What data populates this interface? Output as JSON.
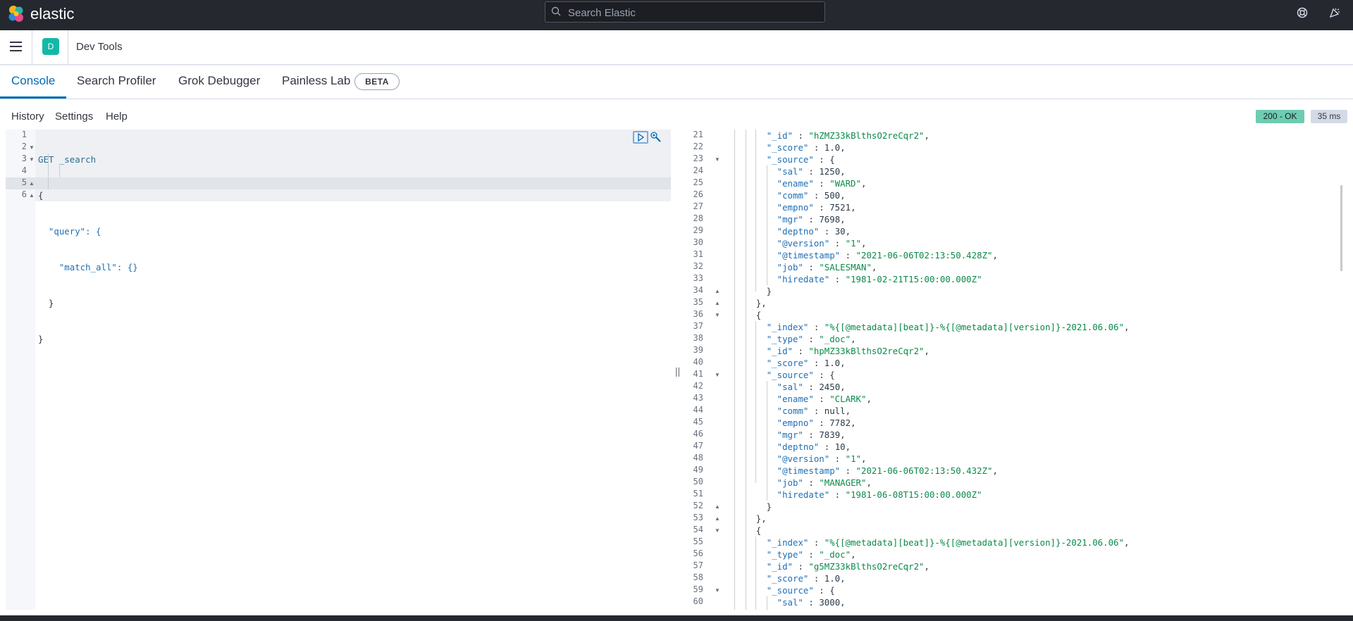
{
  "topbar": {
    "brand": "elastic",
    "search_placeholder": "Search Elastic",
    "icons": [
      "search-icon",
      "help-icon",
      "newsfeed-icon"
    ]
  },
  "appbar": {
    "space_initial": "D",
    "breadcrumb": "Dev Tools"
  },
  "tabs": [
    {
      "label": "Console",
      "active": true
    },
    {
      "label": "Search Profiler",
      "active": false
    },
    {
      "label": "Grok Debugger",
      "active": false
    },
    {
      "label": "Painless Lab",
      "active": false
    }
  ],
  "beta_badge": "BETA",
  "subnav": {
    "history": "History",
    "settings": "Settings",
    "help": "Help"
  },
  "response_status": "200 - OK",
  "response_time": "35 ms",
  "colors": {
    "accent": "#006bb4",
    "status_ok": "#6dccb1",
    "header_bg": "#25282f",
    "space_avatar": "#14b8a6"
  },
  "request_lines": [
    {
      "n": "1",
      "text": "GET _search"
    },
    {
      "n": "2",
      "text": "{"
    },
    {
      "n": "3",
      "text": "  \"query\": {"
    },
    {
      "n": "4",
      "text": "    \"match_all\": {}"
    },
    {
      "n": "5",
      "text": "  }"
    },
    {
      "n": "6",
      "text": "}"
    }
  ],
  "response_lines": [
    {
      "n": "21",
      "text": "        \"_id\" : \"hZMZ33kBlthsO2reCqr2\","
    },
    {
      "n": "22",
      "text": "        \"_score\" : 1.0,"
    },
    {
      "n": "23",
      "text": "        \"_source\" : {"
    },
    {
      "n": "24",
      "text": "          \"sal\" : 1250,"
    },
    {
      "n": "25",
      "text": "          \"ename\" : \"WARD\","
    },
    {
      "n": "26",
      "text": "          \"comm\" : 500,"
    },
    {
      "n": "27",
      "text": "          \"empno\" : 7521,"
    },
    {
      "n": "28",
      "text": "          \"mgr\" : 7698,"
    },
    {
      "n": "29",
      "text": "          \"deptno\" : 30,"
    },
    {
      "n": "30",
      "text": "          \"@version\" : \"1\","
    },
    {
      "n": "31",
      "text": "          \"@timestamp\" : \"2021-06-06T02:13:50.428Z\","
    },
    {
      "n": "32",
      "text": "          \"job\" : \"SALESMAN\","
    },
    {
      "n": "33",
      "text": "          \"hiredate\" : \"1981-02-21T15:00:00.000Z\""
    },
    {
      "n": "34",
      "text": "        }"
    },
    {
      "n": "35",
      "text": "      },"
    },
    {
      "n": "36",
      "text": "      {"
    },
    {
      "n": "37",
      "text": "        \"_index\" : \"%{[@metadata][beat]}-%{[@metadata][version]}-2021.06.06\","
    },
    {
      "n": "38",
      "text": "        \"_type\" : \"_doc\","
    },
    {
      "n": "39",
      "text": "        \"_id\" : \"hpMZ33kBlthsO2reCqr2\","
    },
    {
      "n": "40",
      "text": "        \"_score\" : 1.0,"
    },
    {
      "n": "41",
      "text": "        \"_source\" : {"
    },
    {
      "n": "42",
      "text": "          \"sal\" : 2450,"
    },
    {
      "n": "43",
      "text": "          \"ename\" : \"CLARK\","
    },
    {
      "n": "44",
      "text": "          \"comm\" : null,"
    },
    {
      "n": "45",
      "text": "          \"empno\" : 7782,"
    },
    {
      "n": "46",
      "text": "          \"mgr\" : 7839,"
    },
    {
      "n": "47",
      "text": "          \"deptno\" : 10,"
    },
    {
      "n": "48",
      "text": "          \"@version\" : \"1\","
    },
    {
      "n": "49",
      "text": "          \"@timestamp\" : \"2021-06-06T02:13:50.432Z\","
    },
    {
      "n": "50",
      "text": "          \"job\" : \"MANAGER\","
    },
    {
      "n": "51",
      "text": "          \"hiredate\" : \"1981-06-08T15:00:00.000Z\""
    },
    {
      "n": "52",
      "text": "        }"
    },
    {
      "n": "53",
      "text": "      },"
    },
    {
      "n": "54",
      "text": "      {"
    },
    {
      "n": "55",
      "text": "        \"_index\" : \"%{[@metadata][beat]}-%{[@metadata][version]}-2021.06.06\","
    },
    {
      "n": "56",
      "text": "        \"_type\" : \"_doc\","
    },
    {
      "n": "57",
      "text": "        \"_id\" : \"g5MZ33kBlthsO2reCqr2\","
    },
    {
      "n": "58",
      "text": "        \"_score\" : 1.0,"
    },
    {
      "n": "59",
      "text": "        \"_source\" : {"
    },
    {
      "n": "60",
      "text": "          \"sal\" : 3000,"
    }
  ]
}
